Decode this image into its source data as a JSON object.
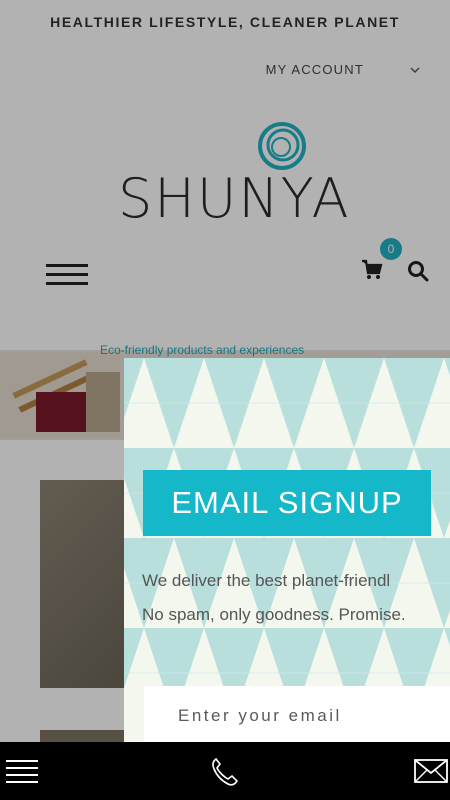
{
  "header": {
    "tagline": "HEALTHIER LIFESTYLE, CLEANER PLANET",
    "account_label": "MY ACCOUNT",
    "logo_text": "SHUNYA",
    "cart_count": "0"
  },
  "banner": {
    "text": "Eco-friendly products and experiences"
  },
  "popup": {
    "title": "EMAIL SIGNUP",
    "line1": "We deliver the best planet-friendl",
    "line2": "No spam, only goodness. Promise.",
    "email_placeholder": "Enter your email"
  },
  "colors": {
    "accent": "#14b8c8",
    "bottom_bar": "#000000"
  },
  "icons": {
    "menu": "hamburger-icon",
    "cart": "cart-icon",
    "search": "search-icon",
    "phone": "phone-icon",
    "mail": "envelope-icon"
  }
}
